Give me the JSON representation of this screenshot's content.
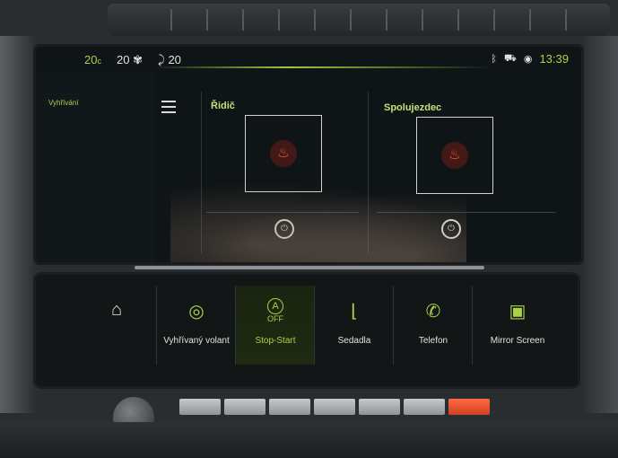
{
  "statusbar": {
    "temp_left": "20",
    "temp_left_unit": "c",
    "fan_temp": "20",
    "seat_temp": "20",
    "time": "13:39",
    "icons": [
      "bluetooth-icon",
      "car-icon",
      "phone-signal-icon"
    ]
  },
  "nav": {
    "section_title": "Vyhřívání"
  },
  "driver": {
    "title": "Řidič",
    "heat_icon": "seat-heat-icon"
  },
  "passenger": {
    "title": "Spolujezdec",
    "heat_icon": "seat-heat-icon"
  },
  "bottom_bar": {
    "buttons": [
      {
        "label": "",
        "icon": "home-icon"
      },
      {
        "label": "Vyhřívaný volant",
        "icon": "steering-heat-icon"
      },
      {
        "label": "Stop-Start",
        "icon": "auto-off-icon",
        "icon_text_top": "A",
        "icon_text_bottom": "OFF"
      },
      {
        "label": "Sedadla",
        "icon": "seat-icon"
      },
      {
        "label": "Telefon",
        "icon": "phone-icon"
      },
      {
        "label": "Mirror Screen",
        "icon": "mirror-screen-icon"
      }
    ]
  },
  "colors": {
    "accent": "#a9d24a",
    "heat": "#ff5a3c",
    "background": "#0f1416"
  }
}
